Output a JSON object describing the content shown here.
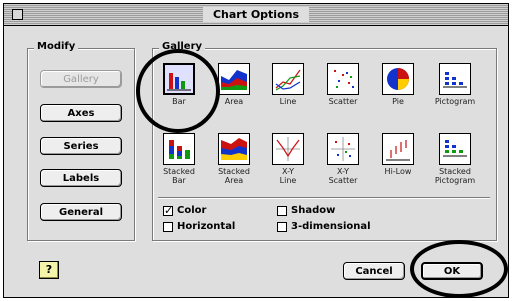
{
  "window": {
    "title": "Chart Options"
  },
  "modify": {
    "label": "Modify",
    "buttons": {
      "gallery": "Gallery",
      "axes": "Axes",
      "series": "Series",
      "labels": "Labels",
      "general": "General"
    }
  },
  "gallery": {
    "label": "Gallery",
    "types": [
      {
        "label": "Bar",
        "icon": "bar-chart-icon",
        "selected": true
      },
      {
        "label": "Area",
        "icon": "area-chart-icon"
      },
      {
        "label": "Line",
        "icon": "line-chart-icon"
      },
      {
        "label": "Scatter",
        "icon": "scatter-chart-icon"
      },
      {
        "label": "Pie",
        "icon": "pie-chart-icon"
      },
      {
        "label": "Pictogram",
        "icon": "pictogram-chart-icon"
      },
      {
        "label": "Stacked\nBar",
        "icon": "stacked-bar-chart-icon"
      },
      {
        "label": "Stacked\nArea",
        "icon": "stacked-area-chart-icon"
      },
      {
        "label": "X-Y\nLine",
        "icon": "xy-line-chart-icon"
      },
      {
        "label": "X-Y\nScatter",
        "icon": "xy-scatter-chart-icon"
      },
      {
        "label": "Hi-Low",
        "icon": "hi-low-chart-icon"
      },
      {
        "label": "Stacked\nPictogram",
        "icon": "stacked-pictogram-chart-icon"
      }
    ]
  },
  "options": {
    "color": {
      "label": "Color",
      "checked": true
    },
    "shadow": {
      "label": "Shadow",
      "checked": false
    },
    "horizontal": {
      "label": "Horizontal",
      "checked": false
    },
    "three_d": {
      "label": "3-dimensional",
      "checked": false
    }
  },
  "footer": {
    "help_label": "?",
    "cancel_label": "Cancel",
    "ok_label": "OK"
  },
  "colors": {
    "red": "#cc1111",
    "blue": "#1133cc",
    "green": "#119911",
    "yellow": "#ffcc00"
  }
}
